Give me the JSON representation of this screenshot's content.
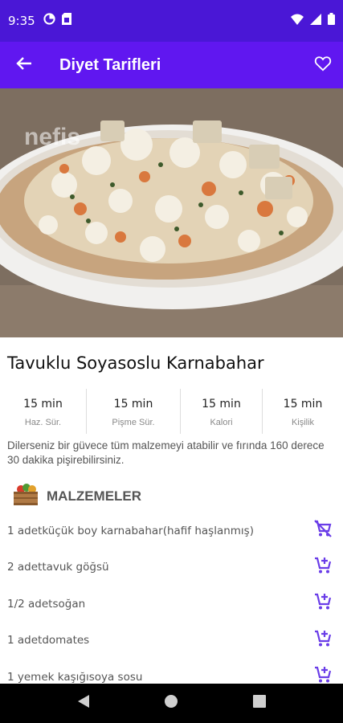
{
  "status_bar": {
    "time": "9:35",
    "icons": [
      "data-saver-icon",
      "sim-card-icon",
      "wifi-icon",
      "signal-icon",
      "battery-icon"
    ]
  },
  "app_bar": {
    "title": "Diyet Tarifleri",
    "back_icon": "arrow-back-icon",
    "favorite_icon": "heart-outline-icon"
  },
  "hero": {
    "watermark": "nefis"
  },
  "recipe": {
    "title": "Tavuklu Soyasoslu Karnabahar",
    "stats": [
      {
        "value": "15 min",
        "label": "Haz. Sür."
      },
      {
        "value": "15 min",
        "label": "Pişme Sür."
      },
      {
        "value": "15 min",
        "label": "Kalori"
      },
      {
        "value": "15 min",
        "label": "Kişilik"
      }
    ],
    "description": "Dilerseniz bir güvece tüm malzemeyi atabilir ve fırında 160 derece 30 dakika pişirebilirsiniz."
  },
  "ingredients": {
    "title": "MALZEMELER",
    "icon": "vegetable-crate-icon",
    "items": [
      {
        "text": "1 adetküçük boy karnabahar(hafif haşlanmış)",
        "icon": "remove-shopping-cart-icon"
      },
      {
        "text": "2 adettavuk göğsü",
        "icon": "add-shopping-cart-icon"
      },
      {
        "text": "1/2 adetsoğan",
        "icon": "add-shopping-cart-icon"
      },
      {
        "text": "1 adetdomates",
        "icon": "add-shopping-cart-icon"
      },
      {
        "text": "1 yemek kaşığısoya sosu",
        "icon": "add-shopping-cart-icon"
      }
    ]
  },
  "colors": {
    "status_bar": "#4a17d6",
    "app_bar": "#6017f0",
    "accent_icon": "#6a3de8"
  },
  "nav_bar": {
    "icons": [
      "back-triangle-icon",
      "home-circle-icon",
      "recents-square-icon"
    ]
  }
}
